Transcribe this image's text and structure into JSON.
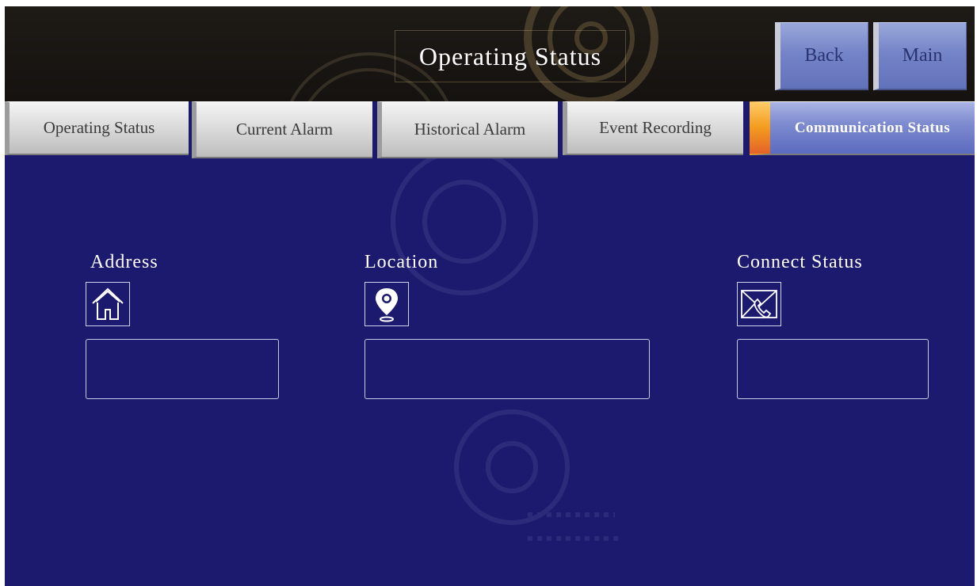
{
  "header": {
    "title": "Operating Status",
    "back_label": "Back",
    "main_label": "Main"
  },
  "tabs": [
    {
      "label": "Operating Status"
    },
    {
      "label": "Current Alarm"
    },
    {
      "label": "Historical Alarm"
    },
    {
      "label": "Event Recording"
    },
    {
      "label": "Communication Status",
      "active": true
    }
  ],
  "fields": {
    "address": {
      "label": "Address",
      "icon": "house-icon",
      "value": ""
    },
    "location": {
      "label": "Location",
      "icon": "map-pin-icon",
      "value": ""
    },
    "connect_status": {
      "label": "Connect Status",
      "icon": "envelope-phone-icon",
      "value": ""
    }
  },
  "colors": {
    "background": "#1c1a6e",
    "header": "#1a1612",
    "active_tab": "#6b7acb",
    "active_tab_marker": "#f39b1e"
  }
}
